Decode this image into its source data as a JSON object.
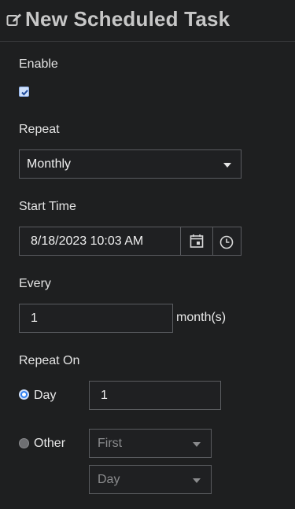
{
  "header": {
    "title": "New Scheduled Task",
    "icon": "edit-icon"
  },
  "enable": {
    "label": "Enable",
    "checked": true
  },
  "repeat": {
    "label": "Repeat",
    "value": "Monthly"
  },
  "start_time": {
    "label": "Start Time",
    "value": "8/18/2023 10:03 AM",
    "icons": [
      "calendar-icon",
      "clock-icon"
    ]
  },
  "every": {
    "label": "Every",
    "value": "1",
    "suffix": "month(s)"
  },
  "repeat_on": {
    "label": "Repeat On",
    "day": {
      "label": "Day",
      "value": "1",
      "selected": true
    },
    "other": {
      "label": "Other",
      "selected": false,
      "ordinal": "First",
      "unit": "Day"
    }
  },
  "colors": {
    "background": "#1e1f20",
    "radio_accent": "#2f7ff0",
    "border": "#5a5c60"
  }
}
